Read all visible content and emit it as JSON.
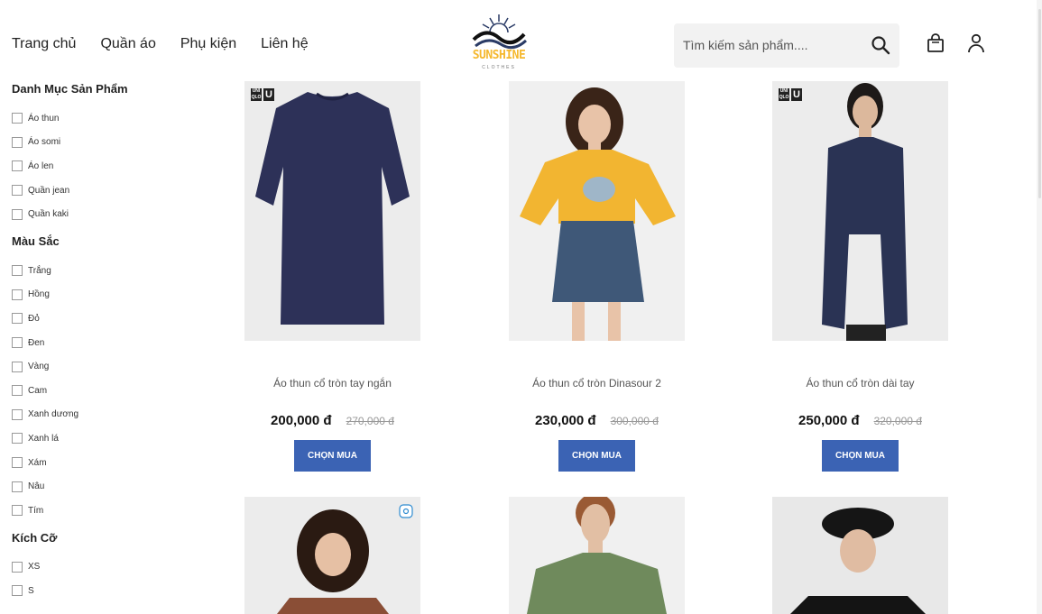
{
  "nav": {
    "items": [
      "Trang chủ",
      "Quần áo",
      "Phụ kiện",
      "Liên hệ"
    ]
  },
  "logo": {
    "brand": "SUNSHINE",
    "tagline": "CLOTHES"
  },
  "search": {
    "placeholder": "Tìm kiếm sản phẩm...."
  },
  "icons": {
    "search": "search-icon",
    "bag": "shopping-bag-icon",
    "user": "user-icon"
  },
  "sidebar": {
    "categories": {
      "title": "Danh Mục Sản Phẩm",
      "items": [
        "Áo thun",
        "Áo somi",
        "Áo len",
        "Quần jean",
        "Quần kaki"
      ]
    },
    "colors": {
      "title": "Màu Sắc",
      "items": [
        "Trắng",
        "Hồng",
        "Đỏ",
        "Đen",
        "Vàng",
        "Cam",
        "Xanh dương",
        "Xanh lá",
        "Xám",
        "Nâu",
        "Tím"
      ]
    },
    "sizes": {
      "title": "Kích Cỡ",
      "items": [
        "XS",
        "S"
      ]
    }
  },
  "products": [
    {
      "title": "Áo thun cổ tròn tay ngắn",
      "price": "200,000 đ",
      "old_price": "270,000 đ",
      "button": "CHỌN MUA"
    },
    {
      "title": "Áo thun cổ tròn Dinasour 2",
      "price": "230,000 đ",
      "old_price": "300,000 đ",
      "button": "CHỌN MUA"
    },
    {
      "title": "Áo thun cổ tròn dài tay",
      "price": "250,000 đ",
      "old_price": "320,000 đ",
      "button": "CHỌN MUA"
    }
  ],
  "colors": {
    "button": "#3b63b4",
    "logo_yellow": "#f5b82e",
    "navy_shirt": "#2d3158",
    "yellow_shirt": "#f2b531",
    "green_shirt": "#6f8a5c"
  }
}
